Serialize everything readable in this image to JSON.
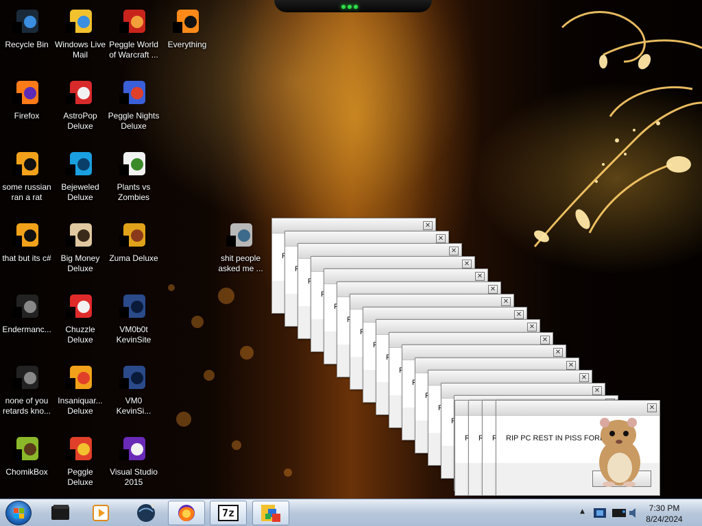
{
  "desktop_icons": [
    {
      "label": "Recycle Bin",
      "icon": "recycle-bin-icon"
    },
    {
      "label": "Windows Live Mail",
      "icon": "windows-live-mail-icon"
    },
    {
      "label": "Peggle World of Warcraft ...",
      "icon": "peggle-wow-icon"
    },
    {
      "label": "Everything",
      "icon": "everything-search-icon"
    },
    {
      "label": "Firefox",
      "icon": "firefox-icon"
    },
    {
      "label": "AstroPop Deluxe",
      "icon": "astropop-icon"
    },
    {
      "label": "Peggle Nights Deluxe",
      "icon": "peggle-nights-icon"
    },
    {
      "label": "some russian ran a rat",
      "icon": "shortcut-icon"
    },
    {
      "label": "Bejeweled Deluxe",
      "icon": "bejeweled-icon"
    },
    {
      "label": "Plants vs Zombies",
      "icon": "plants-vs-zombies-icon"
    },
    {
      "label": "that but its c#",
      "icon": "shortcut-icon"
    },
    {
      "label": "Big Money Deluxe",
      "icon": "big-money-icon"
    },
    {
      "label": "Zuma Deluxe",
      "icon": "zuma-icon"
    },
    {
      "label": "Endermanc...",
      "icon": "application-icon"
    },
    {
      "label": "Chuzzle Deluxe",
      "icon": "chuzzle-icon"
    },
    {
      "label": "VM0b0t KevinSite",
      "icon": "vm-icon"
    },
    {
      "label": "none of you retards kno...",
      "icon": "application-icon"
    },
    {
      "label": "Insaniquar... Deluxe",
      "icon": "insaniquarium-icon"
    },
    {
      "label": "VM0 KevinSi...",
      "icon": "vm-icon"
    },
    {
      "label": "ChomikBox",
      "icon": "chomikbox-icon"
    },
    {
      "label": "Peggle Deluxe",
      "icon": "peggle-icon"
    },
    {
      "label": "Visual Studio 2015",
      "icon": "visual-studio-icon"
    },
    {
      "label": "shit people asked me ...",
      "icon": "folder-icon"
    }
  ],
  "dialogs": {
    "message_short": "RIP",
    "message_partial": "R",
    "message_full": "RIP PC REST IN PISS FOREVER",
    "close_glyph": "✕",
    "count": 19
  },
  "taskbar": {
    "items": [
      "file-manager-icon",
      "media-player-icon",
      "globe-icon",
      "firefox-icon",
      "7zip-icon",
      "app-icon"
    ],
    "sevenzip_text": "7z",
    "tray": {
      "show_hidden_glyph": "▲",
      "clock_time": "7:30 PM",
      "clock_date": "8/24/2024"
    }
  },
  "colors": {
    "accent_gold": "#ffb020",
    "taskbar": "#b9c9dc",
    "dialog_title": "#d8d8d8"
  }
}
